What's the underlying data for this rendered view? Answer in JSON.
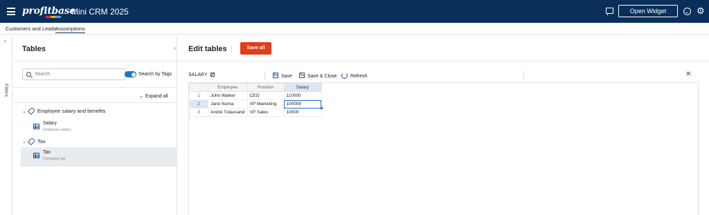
{
  "app": {
    "logo": "profitbase",
    "title": "Mini CRM 2025",
    "open_widget_label": "Open Widget"
  },
  "nav": {
    "tabs": [
      {
        "label": "Customers and Leads",
        "active": false
      },
      {
        "label": "Assumptions",
        "active": true
      }
    ]
  },
  "filters": {
    "label": "Filters"
  },
  "left": {
    "title": "Tables",
    "search_placeholder": "Search",
    "search_by_tags_label": "Search by Tags",
    "search_by_tags_on": true,
    "expand_all_label": "Expand all",
    "groups": [
      {
        "name": "Employee salary and benefits",
        "items": [
          {
            "name": "Salary",
            "desc": "Employee salary",
            "selected": false
          }
        ]
      },
      {
        "name": "Tax",
        "items": [
          {
            "name": "Tax",
            "desc": "Company tax",
            "selected": true
          }
        ]
      }
    ]
  },
  "right": {
    "title": "Edit tables",
    "save_all_label": "Save all",
    "table_name": "SALARY",
    "toolbar": {
      "save": "Save",
      "save_close": "Save & Close",
      "refresh": "Refresh"
    },
    "grid": {
      "columns": [
        "Employee",
        "Position",
        "Salary"
      ],
      "active_column": 2,
      "rows": [
        {
          "n": "1",
          "cells": [
            "John Walker",
            "CEO",
            "110000"
          ]
        },
        {
          "n": "2",
          "cells": [
            "Jane Numa",
            "VP Marketing",
            "100000"
          ]
        },
        {
          "n": "3",
          "cells": [
            "André Tutausand",
            "VP Sales",
            "10000"
          ]
        }
      ],
      "active_row": 1
    }
  },
  "colors": {
    "topbar": "#0b2f5b",
    "save_all": "#e03d18",
    "accent": "#1a73c7"
  }
}
